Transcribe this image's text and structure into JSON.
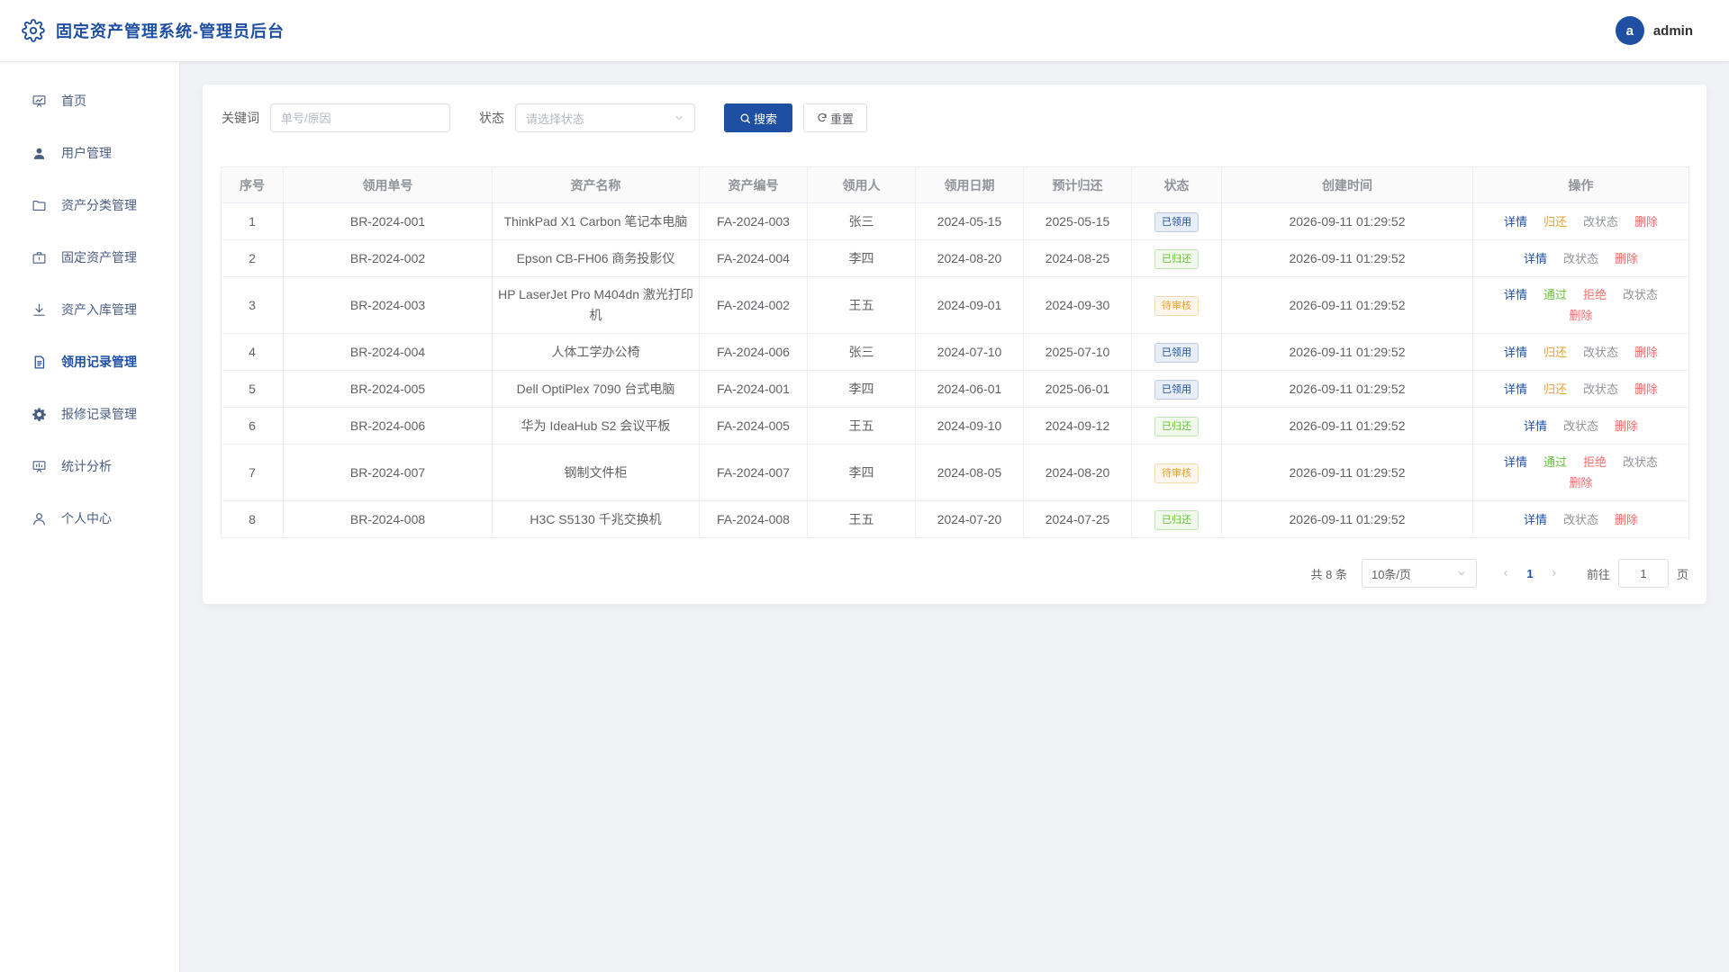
{
  "header": {
    "title": "固定资产管理系统-管理员后台",
    "avatar_letter": "a",
    "username": "admin"
  },
  "sidebar": {
    "items": [
      {
        "label": "首页",
        "icon": "dashboard-icon"
      },
      {
        "label": "用户管理",
        "icon": "user-icon"
      },
      {
        "label": "资产分类管理",
        "icon": "folder-icon"
      },
      {
        "label": "固定资产管理",
        "icon": "briefcase-icon"
      },
      {
        "label": "资产入库管理",
        "icon": "download-icon"
      },
      {
        "label": "领用记录管理",
        "icon": "document-icon",
        "active": true
      },
      {
        "label": "报修记录管理",
        "icon": "gear-icon"
      },
      {
        "label": "统计分析",
        "icon": "chart-board-icon"
      },
      {
        "label": "个人中心",
        "icon": "person-icon"
      }
    ]
  },
  "filter": {
    "keyword_label": "关键词",
    "keyword_placeholder": "单号/原因",
    "status_label": "状态",
    "status_placeholder": "请选择状态",
    "search_label": "搜索",
    "reset_label": "重置"
  },
  "table": {
    "columns": [
      "序号",
      "领用单号",
      "资产名称",
      "资产编号",
      "领用人",
      "领用日期",
      "预计归还",
      "状态",
      "创建时间",
      "操作"
    ],
    "rows": [
      {
        "no": "1",
        "order": "BR-2024-001",
        "asset": "ThinkPad X1 Carbon 笔记本电脑",
        "code": "FA-2024-003",
        "person": "张三",
        "date": "2024-05-15",
        "due": "2025-05-15",
        "status": "已领用",
        "status_type": "borrowed",
        "created": "2026-09-11 01:29:52"
      },
      {
        "no": "2",
        "order": "BR-2024-002",
        "asset": "Epson CB-FH06 商务投影仪",
        "code": "FA-2024-004",
        "person": "李四",
        "date": "2024-08-20",
        "due": "2024-08-25",
        "status": "已归还",
        "status_type": "returned",
        "created": "2026-09-11 01:29:52"
      },
      {
        "no": "3",
        "order": "BR-2024-003",
        "asset": "HP LaserJet Pro M404dn 激光打印机",
        "code": "FA-2024-002",
        "person": "王五",
        "date": "2024-09-01",
        "due": "2024-09-30",
        "status": "待审核",
        "status_type": "pending",
        "created": "2026-09-11 01:29:52"
      },
      {
        "no": "4",
        "order": "BR-2024-004",
        "asset": "人体工学办公椅",
        "code": "FA-2024-006",
        "person": "张三",
        "date": "2024-07-10",
        "due": "2025-07-10",
        "status": "已领用",
        "status_type": "borrowed",
        "created": "2026-09-11 01:29:52"
      },
      {
        "no": "5",
        "order": "BR-2024-005",
        "asset": "Dell OptiPlex 7090 台式电脑",
        "code": "FA-2024-001",
        "person": "李四",
        "date": "2024-06-01",
        "due": "2025-06-01",
        "status": "已领用",
        "status_type": "borrowed",
        "created": "2026-09-11 01:29:52"
      },
      {
        "no": "6",
        "order": "BR-2024-006",
        "asset": "华为 IdeaHub S2 会议平板",
        "code": "FA-2024-005",
        "person": "王五",
        "date": "2024-09-10",
        "due": "2024-09-12",
        "status": "已归还",
        "status_type": "returned",
        "created": "2026-09-11 01:29:52"
      },
      {
        "no": "7",
        "order": "BR-2024-007",
        "asset": "钢制文件柜",
        "code": "FA-2024-007",
        "person": "李四",
        "date": "2024-08-05",
        "due": "2024-08-20",
        "status": "待审核",
        "status_type": "pending",
        "created": "2026-09-11 01:29:52"
      },
      {
        "no": "8",
        "order": "BR-2024-008",
        "asset": "H3C S5130 千兆交换机",
        "code": "FA-2024-008",
        "person": "王五",
        "date": "2024-07-20",
        "due": "2024-07-25",
        "status": "已归还",
        "status_type": "returned",
        "created": "2026-09-11 01:29:52"
      }
    ],
    "ops": {
      "borrowed": [
        [
          "detail",
          "详情"
        ],
        [
          "return",
          "归还"
        ],
        [
          "status",
          "改状态"
        ],
        [
          "delete",
          "删除"
        ]
      ],
      "returned": [
        [
          "detail",
          "详情"
        ],
        [
          "status",
          "改状态"
        ],
        [
          "delete",
          "删除"
        ]
      ],
      "pending": [
        [
          "detail",
          "详情"
        ],
        [
          "approve",
          "通过"
        ],
        [
          "reject",
          "拒绝"
        ],
        [
          "status",
          "改状态"
        ],
        [
          "delete",
          "删除"
        ]
      ]
    },
    "status_colors": {
      "borrowed": {
        "fg": "#1f4fa3",
        "bg": "#e8eef8",
        "border": "#bccbe6"
      },
      "returned": {
        "fg": "#67c23a",
        "bg": "#f0f9eb",
        "border": "#c2e7b0"
      },
      "pending": {
        "fg": "#e6a23c",
        "bg": "#fdf6ec",
        "border": "#f5dab1"
      }
    }
  },
  "pagination": {
    "total_text": "共 8 条",
    "page_size": "10条/页",
    "current": "1",
    "goto_label": "前往",
    "goto_value": "1",
    "page_suffix": "页"
  },
  "colors": {
    "primary": "#1f4fa3"
  }
}
